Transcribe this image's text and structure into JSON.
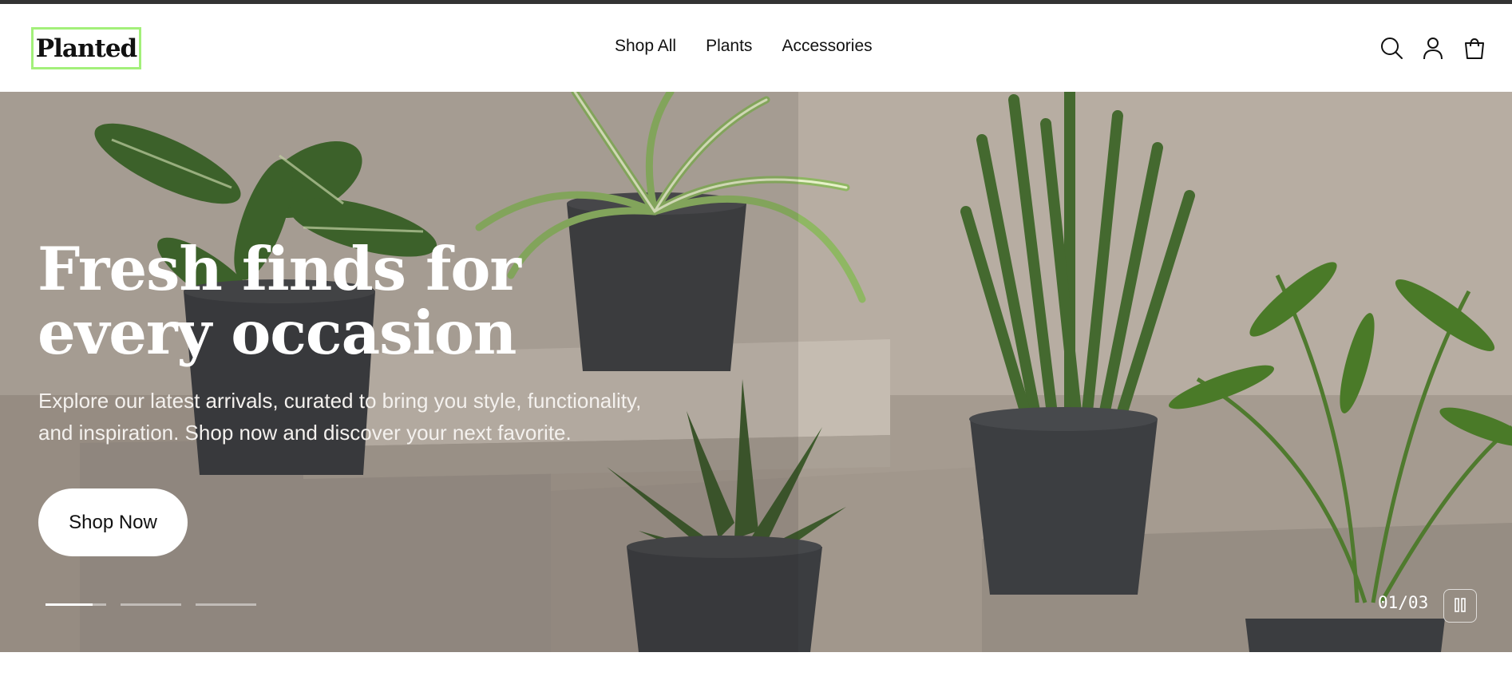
{
  "header": {
    "logo": "Planted",
    "nav": [
      "Shop All",
      "Plants",
      "Accessories"
    ],
    "icons": [
      "search-icon",
      "account-icon",
      "cart-icon"
    ]
  },
  "hero": {
    "title_line1": "Fresh finds for",
    "title_line2": "every occasion",
    "subtitle_line1": "Explore our latest arrivals, curated to bring you style, functionality,",
    "subtitle_line2": "and inspiration. Shop now and discover your next favorite.",
    "cta_label": "Shop Now",
    "slide_counter": "01/03",
    "slides_total": 3,
    "active_slide": 1,
    "active_slide_progress": 0.78
  },
  "colors": {
    "logo_border": "#a3f07a",
    "top_bar": "#333333"
  }
}
